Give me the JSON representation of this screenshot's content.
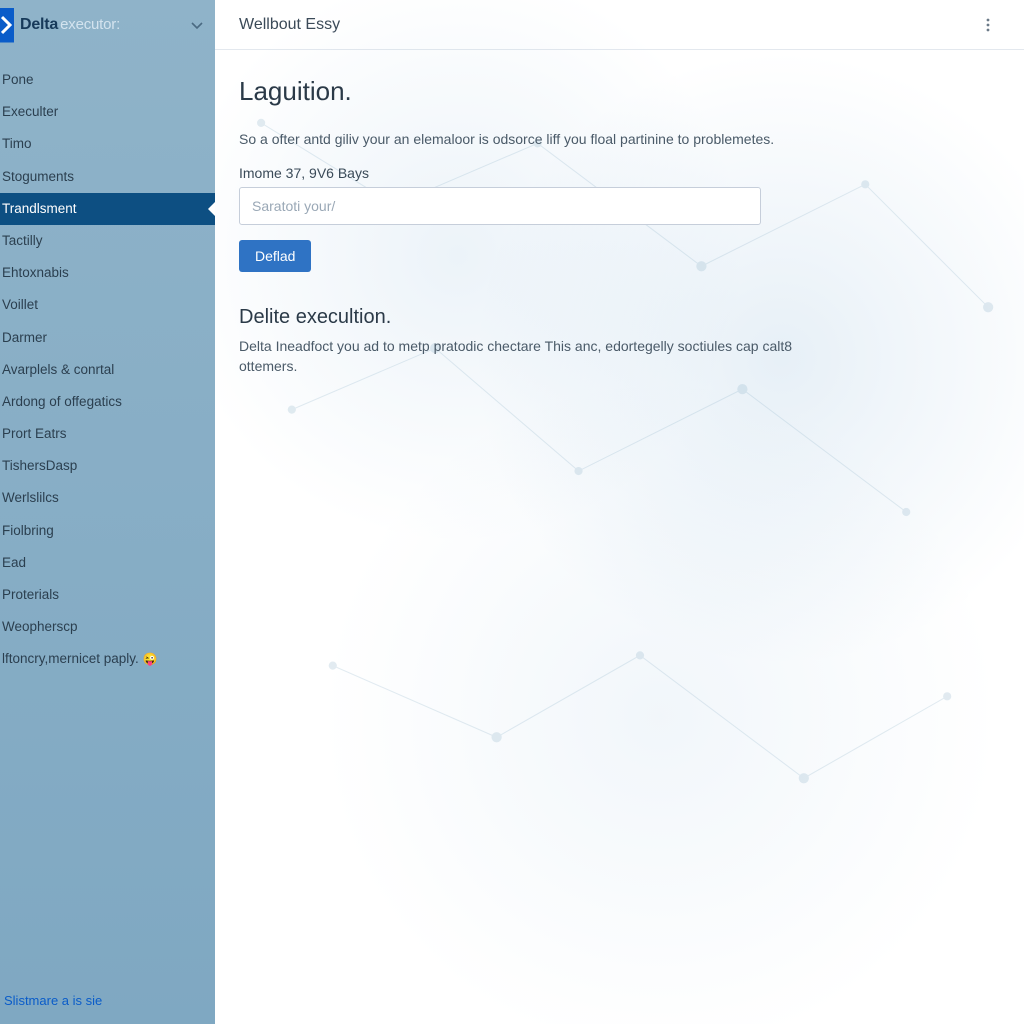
{
  "brand": {
    "name": "Delta",
    "sub": "executor:"
  },
  "topbar": {
    "title": "Wellbout Essy"
  },
  "page": {
    "h1": "Laguition.",
    "intro": "So a ofter antd giliv your an elemaloor is odsorce liff you floal partinine to problemetes.",
    "field_label": "Imome 37, 9V6 Bays",
    "input_placeholder": "Saratoti your/",
    "button": "Deflad",
    "section_h2": "Delite execultion.",
    "section_body": "Delta Ineadfoct you ad to metp pratodic chectare This anc, edortegelly soctiules cap calt8 ottemers."
  },
  "sidebar": {
    "items": [
      {
        "label": "Pone"
      },
      {
        "label": "Execulter"
      },
      {
        "label": "Timo"
      },
      {
        "label": "Stoguments"
      },
      {
        "label": "Trandlsment",
        "active": true
      },
      {
        "label": "Tactilly"
      },
      {
        "label": "Ehtoxnabis"
      },
      {
        "label": "Voillet"
      },
      {
        "label": "Darmer"
      },
      {
        "label": "Avarplels & conrtal"
      },
      {
        "label": "Ardong of offegatics"
      },
      {
        "label": "Prort Eatrs"
      },
      {
        "label": "TishersDasp"
      },
      {
        "label": "Werlslilcs"
      },
      {
        "label": "Fiolbring"
      },
      {
        "label": "Ead"
      },
      {
        "label": "Proterials"
      },
      {
        "label": "Weopherscp"
      },
      {
        "label": "lftoncry,mernicet paply.",
        "badge": "😜"
      }
    ],
    "footer_link": "Slistmare a is sie"
  }
}
